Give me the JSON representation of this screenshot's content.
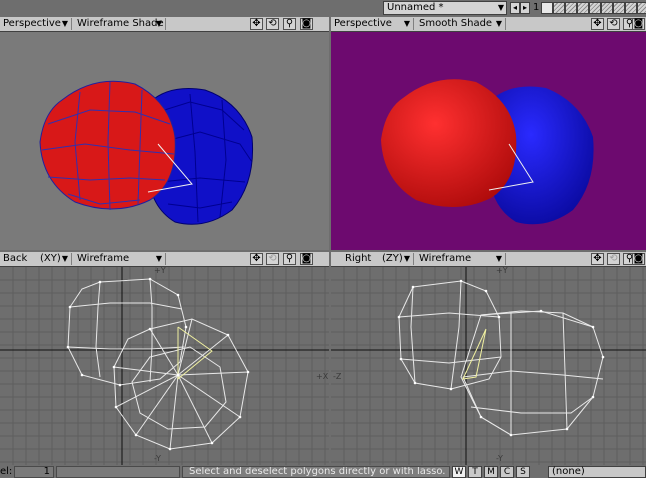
{
  "topbar": {
    "scene_name": "Unnamed *",
    "layer_number": "1",
    "layer_count": 10
  },
  "viewports": [
    {
      "key": "tl",
      "view": "Perspective",
      "view_axis": "",
      "render_mode": "Wireframe Shade",
      "background": "#7a7a7a"
    },
    {
      "key": "tr",
      "view": "Perspective",
      "view_axis": "",
      "render_mode": "Smooth Shade",
      "background": "#6d0a6f"
    },
    {
      "key": "bl",
      "view": "Back",
      "view_axis": "(XY)",
      "render_mode": "Wireframe",
      "background": "#6e6e6e",
      "axis_labels": {
        "top": "+Y",
        "bottom": "-Y",
        "right": "+X"
      }
    },
    {
      "key": "br",
      "view": "Right",
      "view_axis": "(ZY)",
      "render_mode": "Wireframe",
      "background": "#6e6e6e",
      "axis_labels": {
        "top": "+Y",
        "bottom": "-Y",
        "left": "-Z"
      }
    }
  ],
  "viewport_icons": [
    "move-icon",
    "rotate-icon",
    "zoom-icon",
    "maximize-icon"
  ],
  "colors": {
    "red_object": "#d81818",
    "blue_object": "#1010c8",
    "wire": "#e8e8e8",
    "selected_edge": "#f0f0a0",
    "grid_line": "#5e5e5e",
    "axis_line": "#101010"
  },
  "statusbar": {
    "label": "el:",
    "value": "1",
    "message": "Select and deselect polygons directly or with lasso.",
    "modes": [
      "W",
      "T",
      "M",
      "C",
      "S"
    ],
    "active_mode": "W",
    "selection": "(none)"
  }
}
